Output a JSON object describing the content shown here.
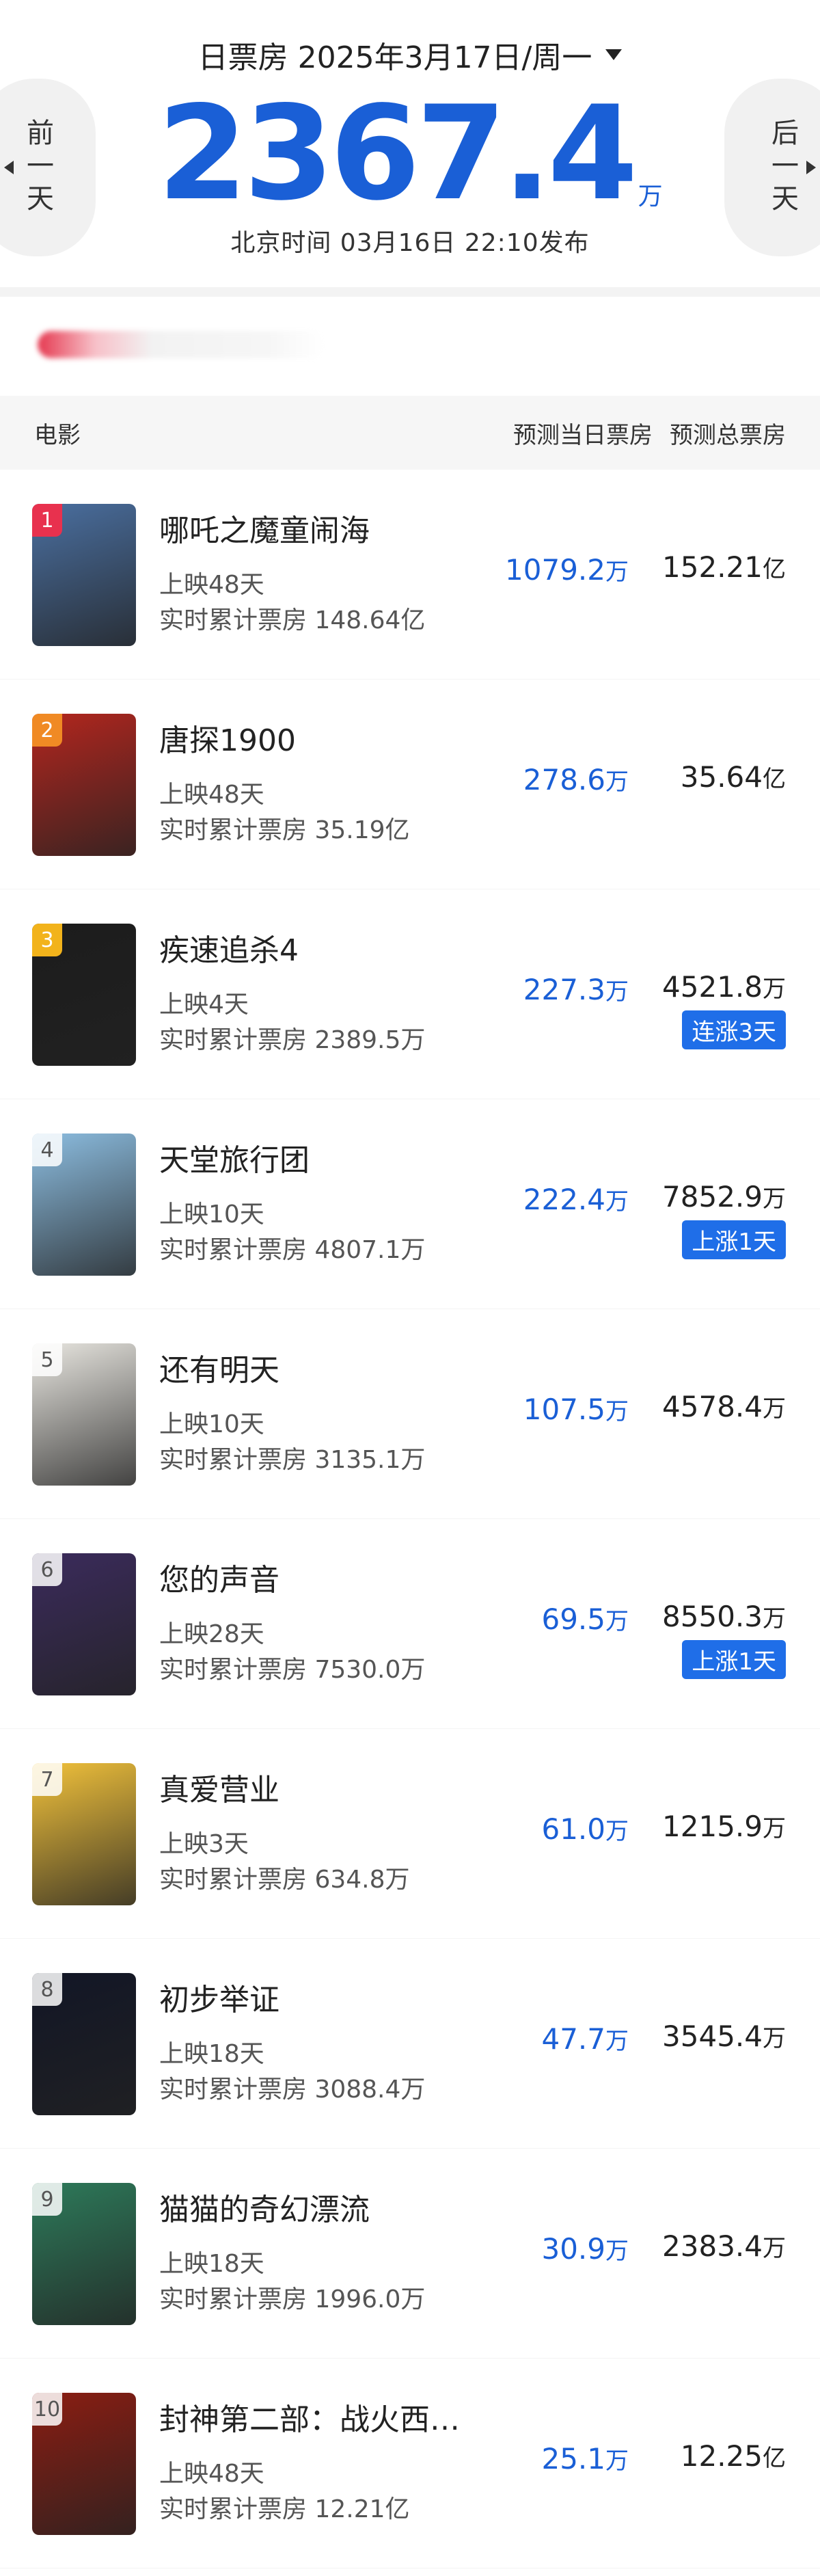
{
  "header": {
    "date_label": "日票房 2025年3月17日/周一",
    "prev_label": "前一天",
    "next_label": "后一天",
    "total_value": "2367.4",
    "total_unit": "万",
    "release_text": "北京时间  03月16日  22:10发布"
  },
  "table": {
    "col_movie": "电影",
    "col_pred_day": "预测当日票房",
    "col_pred_total": "预测总票房"
  },
  "rows": [
    {
      "rank": "1",
      "title": "哪吒之魔童闹海",
      "days": "上映48天",
      "cum": "实时累计票房 148.64亿",
      "pred_day": "1079.2",
      "pred_day_unit": "万",
      "pred_total": "152.21",
      "pred_total_unit": "亿",
      "tag": "",
      "poster_color": "#4a6fa0"
    },
    {
      "rank": "2",
      "title": "唐探1900",
      "days": "上映48天",
      "cum": "实时累计票房 35.19亿",
      "pred_day": "278.6",
      "pred_day_unit": "万",
      "pred_total": "35.64",
      "pred_total_unit": "亿",
      "tag": "",
      "poster_color": "#b3261e"
    },
    {
      "rank": "3",
      "title": "疾速追杀4",
      "days": "上映4天",
      "cum": "实时累计票房 2389.5万",
      "pred_day": "227.3",
      "pred_day_unit": "万",
      "pred_total": "4521.8",
      "pred_total_unit": "万",
      "tag": "连涨3天",
      "poster_color": "#1c1c1c"
    },
    {
      "rank": "4",
      "title": "天堂旅行团",
      "days": "上映10天",
      "cum": "实时累计票房 4807.1万",
      "pred_day": "222.4",
      "pred_day_unit": "万",
      "pred_total": "7852.9",
      "pred_total_unit": "万",
      "tag": "上涨1天",
      "poster_color": "#8cbde0"
    },
    {
      "rank": "5",
      "title": "还有明天",
      "days": "上映10天",
      "cum": "实时累计票房 3135.1万",
      "pred_day": "107.5",
      "pred_day_unit": "万",
      "pred_total": "4578.4",
      "pred_total_unit": "万",
      "tag": "",
      "poster_color": "#e8e6e0"
    },
    {
      "rank": "6",
      "title": "您的声音",
      "days": "上映28天",
      "cum": "实时累计票房 7530.0万",
      "pred_day": "69.5",
      "pred_day_unit": "万",
      "pred_total": "8550.3",
      "pred_total_unit": "万",
      "tag": "上涨1天",
      "poster_color": "#3b2b5c"
    },
    {
      "rank": "7",
      "title": "真爱营业",
      "days": "上映3天",
      "cum": "实时累计票房 634.8万",
      "pred_day": "61.0",
      "pred_day_unit": "万",
      "pred_total": "1215.9",
      "pred_total_unit": "万",
      "tag": "",
      "poster_color": "#f2c23b"
    },
    {
      "rank": "8",
      "title": "初步举证",
      "days": "上映18天",
      "cum": "实时累计票房 3088.4万",
      "pred_day": "47.7",
      "pred_day_unit": "万",
      "pred_total": "3545.4",
      "pred_total_unit": "万",
      "tag": "",
      "poster_color": "#121626"
    },
    {
      "rank": "9",
      "title": "猫猫的奇幻漂流",
      "days": "上映18天",
      "cum": "实时累计票房 1996.0万",
      "pred_day": "30.9",
      "pred_day_unit": "万",
      "pred_total": "2383.4",
      "pred_total_unit": "万",
      "tag": "",
      "poster_color": "#2d7a5a"
    },
    {
      "rank": "10",
      "title": "封神第二部：战火西…",
      "days": "上映48天",
      "cum": "实时累计票房 12.21亿",
      "pred_day": "25.1",
      "pred_day_unit": "万",
      "pred_total": "12.25",
      "pred_total_unit": "亿",
      "tag": "",
      "poster_color": "#8b1d12"
    }
  ]
}
